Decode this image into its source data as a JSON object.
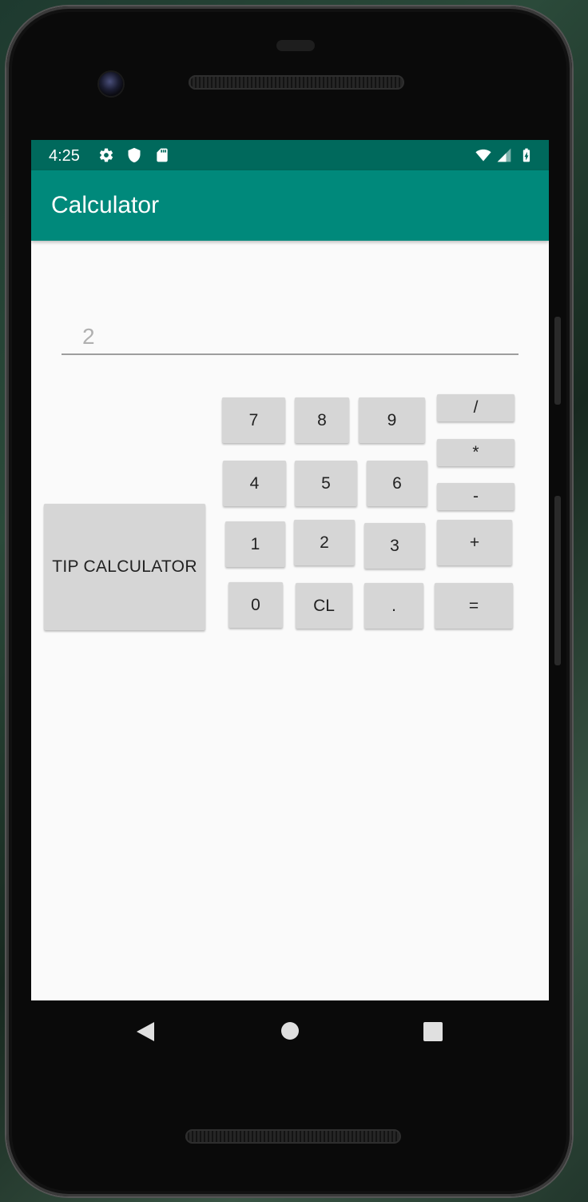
{
  "status_bar": {
    "time": "4:25",
    "left_icons": [
      "gear-icon",
      "shield-icon",
      "sd-card-icon"
    ],
    "right_icons": [
      "wifi-icon",
      "signal-icon",
      "battery-icon"
    ]
  },
  "app_bar": {
    "title": "Calculator"
  },
  "display": {
    "value": "",
    "placeholder": "2"
  },
  "buttons": {
    "tip": "TIP CALCULATOR",
    "seven": "7",
    "eight": "8",
    "nine": "9",
    "four": "4",
    "five": "5",
    "six": "6",
    "one": "1",
    "two": "2",
    "three": "3",
    "zero": "0",
    "clear": "CL",
    "dot": ".",
    "divide": "/",
    "multiply": "*",
    "minus": "-",
    "plus": "+",
    "equals": "="
  },
  "nav_bar": {
    "icons": [
      "back-icon",
      "home-icon",
      "recents-icon"
    ]
  },
  "colors": {
    "status_bar": "#00695c",
    "app_bar": "#00897b",
    "button": "#d6d6d6",
    "background": "#fafafa"
  }
}
